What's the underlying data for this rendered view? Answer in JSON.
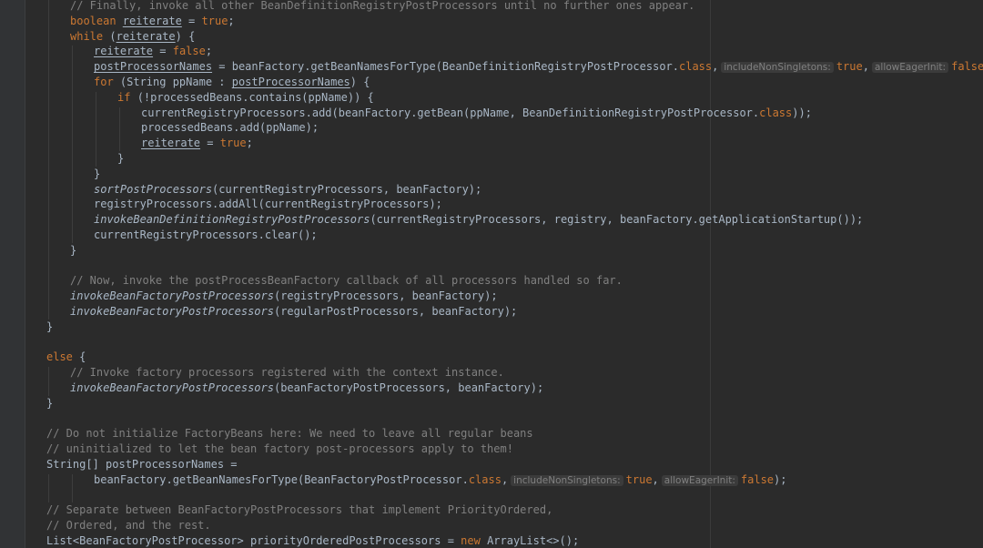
{
  "editor": {
    "language": "java",
    "colors": {
      "background": "#2b2b2b",
      "gutter": "#313335",
      "comment": "#808080",
      "keyword": "#cc7832",
      "text": "#a9b7c6",
      "hint_background": "#3b3b3b"
    }
  },
  "code_lines": [
    {
      "indent": 2,
      "tokens": [
        {
          "t": "comment",
          "v": "// Finally, invoke all other BeanDefinitionRegistryPostProcessors until no further ones appear."
        }
      ]
    },
    {
      "indent": 2,
      "tokens": [
        {
          "t": "keyword",
          "v": "boolean "
        },
        {
          "t": "field",
          "v": "reiterate"
        },
        {
          "t": "plain",
          "v": " = "
        },
        {
          "t": "keyword",
          "v": "true"
        },
        {
          "t": "plain",
          "v": ";"
        }
      ]
    },
    {
      "indent": 2,
      "tokens": [
        {
          "t": "keyword",
          "v": "while "
        },
        {
          "t": "plain",
          "v": "("
        },
        {
          "t": "field",
          "v": "reiterate"
        },
        {
          "t": "plain",
          "v": ") {"
        }
      ]
    },
    {
      "indent": 3,
      "tokens": [
        {
          "t": "field",
          "v": "reiterate"
        },
        {
          "t": "plain",
          "v": " = "
        },
        {
          "t": "keyword",
          "v": "false"
        },
        {
          "t": "plain",
          "v": ";"
        }
      ]
    },
    {
      "indent": 3,
      "tokens": [
        {
          "t": "field",
          "v": "postProcessorNames"
        },
        {
          "t": "plain",
          "v": " = beanFactory.getBeanNamesForType(BeanDefinitionRegistryPostProcessor."
        },
        {
          "t": "keyword",
          "v": "class"
        },
        {
          "t": "plain",
          "v": ","
        },
        {
          "t": "hint",
          "v": "includeNonSingletons:"
        },
        {
          "t": "keyword",
          "v": "true"
        },
        {
          "t": "plain",
          "v": ","
        },
        {
          "t": "hint",
          "v": "allowEagerInit:"
        },
        {
          "t": "keyword",
          "v": "false"
        },
        {
          "t": "plain",
          "v": ");"
        }
      ]
    },
    {
      "indent": 3,
      "tokens": [
        {
          "t": "keyword",
          "v": "for "
        },
        {
          "t": "plain",
          "v": "(String ppName : "
        },
        {
          "t": "field",
          "v": "postProcessorNames"
        },
        {
          "t": "plain",
          "v": ") {"
        }
      ]
    },
    {
      "indent": 4,
      "tokens": [
        {
          "t": "keyword",
          "v": "if "
        },
        {
          "t": "plain",
          "v": "(!processedBeans.contains(ppName)) {"
        }
      ]
    },
    {
      "indent": 5,
      "tokens": [
        {
          "t": "plain",
          "v": "currentRegistryProcessors.add(beanFactory.getBean(ppName, BeanDefinitionRegistryPostProcessor."
        },
        {
          "t": "keyword",
          "v": "class"
        },
        {
          "t": "plain",
          "v": "));"
        }
      ]
    },
    {
      "indent": 5,
      "tokens": [
        {
          "t": "plain",
          "v": "processedBeans.add(ppName);"
        }
      ]
    },
    {
      "indent": 5,
      "tokens": [
        {
          "t": "field",
          "v": "reiterate"
        },
        {
          "t": "plain",
          "v": " = "
        },
        {
          "t": "keyword",
          "v": "true"
        },
        {
          "t": "plain",
          "v": ";"
        }
      ]
    },
    {
      "indent": 4,
      "tokens": [
        {
          "t": "plain",
          "v": "}"
        }
      ]
    },
    {
      "indent": 3,
      "tokens": [
        {
          "t": "plain",
          "v": "}"
        }
      ]
    },
    {
      "indent": 3,
      "tokens": [
        {
          "t": "static",
          "v": "sortPostProcessors"
        },
        {
          "t": "plain",
          "v": "(currentRegistryProcessors, beanFactory);"
        }
      ]
    },
    {
      "indent": 3,
      "tokens": [
        {
          "t": "plain",
          "v": "registryProcessors.addAll(currentRegistryProcessors);"
        }
      ]
    },
    {
      "indent": 3,
      "tokens": [
        {
          "t": "static",
          "v": "invokeBeanDefinitionRegistryPostProcessors"
        },
        {
          "t": "plain",
          "v": "(currentRegistryProcessors, registry, beanFactory.getApplicationStartup());"
        }
      ]
    },
    {
      "indent": 3,
      "tokens": [
        {
          "t": "plain",
          "v": "currentRegistryProcessors.clear();"
        }
      ]
    },
    {
      "indent": 2,
      "tokens": [
        {
          "t": "plain",
          "v": "}"
        }
      ]
    },
    {
      "indent": 0,
      "tokens": []
    },
    {
      "indent": 2,
      "tokens": [
        {
          "t": "comment",
          "v": "// Now, invoke the postProcessBeanFactory callback of all processors handled so far."
        }
      ]
    },
    {
      "indent": 2,
      "tokens": [
        {
          "t": "static",
          "v": "invokeBeanFactoryPostProcessors"
        },
        {
          "t": "plain",
          "v": "(registryProcessors, beanFactory);"
        }
      ]
    },
    {
      "indent": 2,
      "tokens": [
        {
          "t": "static",
          "v": "invokeBeanFactoryPostProcessors"
        },
        {
          "t": "plain",
          "v": "(regularPostProcessors, beanFactory);"
        }
      ]
    },
    {
      "indent": 1,
      "tokens": [
        {
          "t": "plain",
          "v": "}"
        }
      ]
    },
    {
      "indent": 0,
      "tokens": []
    },
    {
      "indent": 1,
      "tokens": [
        {
          "t": "keyword",
          "v": "else "
        },
        {
          "t": "plain",
          "v": "{"
        }
      ]
    },
    {
      "indent": 2,
      "tokens": [
        {
          "t": "comment",
          "v": "// Invoke factory processors registered with the context instance."
        }
      ]
    },
    {
      "indent": 2,
      "tokens": [
        {
          "t": "static",
          "v": "invokeBeanFactoryPostProcessors"
        },
        {
          "t": "plain",
          "v": "(beanFactoryPostProcessors, beanFactory);"
        }
      ]
    },
    {
      "indent": 1,
      "tokens": [
        {
          "t": "plain",
          "v": "}"
        }
      ]
    },
    {
      "indent": 0,
      "tokens": []
    },
    {
      "indent": 1,
      "tokens": [
        {
          "t": "comment",
          "v": "// Do not initialize FactoryBeans here: We need to leave all regular beans"
        }
      ]
    },
    {
      "indent": 1,
      "tokens": [
        {
          "t": "comment",
          "v": "// uninitialized to let the bean factory post-processors apply to them!"
        }
      ]
    },
    {
      "indent": 1,
      "tokens": [
        {
          "t": "plain",
          "v": "String[] postProcessorNames ="
        }
      ]
    },
    {
      "indent": 3,
      "tokens": [
        {
          "t": "plain",
          "v": "beanFactory.getBeanNamesForType(BeanFactoryPostProcessor."
        },
        {
          "t": "keyword",
          "v": "class"
        },
        {
          "t": "plain",
          "v": ","
        },
        {
          "t": "hint",
          "v": "includeNonSingletons:"
        },
        {
          "t": "keyword",
          "v": "true"
        },
        {
          "t": "plain",
          "v": ","
        },
        {
          "t": "hint",
          "v": "allowEagerInit:"
        },
        {
          "t": "keyword",
          "v": "false"
        },
        {
          "t": "plain",
          "v": ");"
        }
      ]
    },
    {
      "indent": 0,
      "tokens": []
    },
    {
      "indent": 1,
      "tokens": [
        {
          "t": "comment",
          "v": "// Separate between BeanFactoryPostProcessors that implement PriorityOrdered,"
        }
      ]
    },
    {
      "indent": 1,
      "tokens": [
        {
          "t": "comment",
          "v": "// Ordered, and the rest."
        }
      ]
    },
    {
      "indent": 1,
      "tokens": [
        {
          "t": "plain",
          "v": "List<BeanFactoryPostProcessor> priorityOrderedPostProcessors = "
        },
        {
          "t": "keyword",
          "v": "new "
        },
        {
          "t": "plain",
          "v": "ArrayList<>();"
        }
      ]
    }
  ]
}
